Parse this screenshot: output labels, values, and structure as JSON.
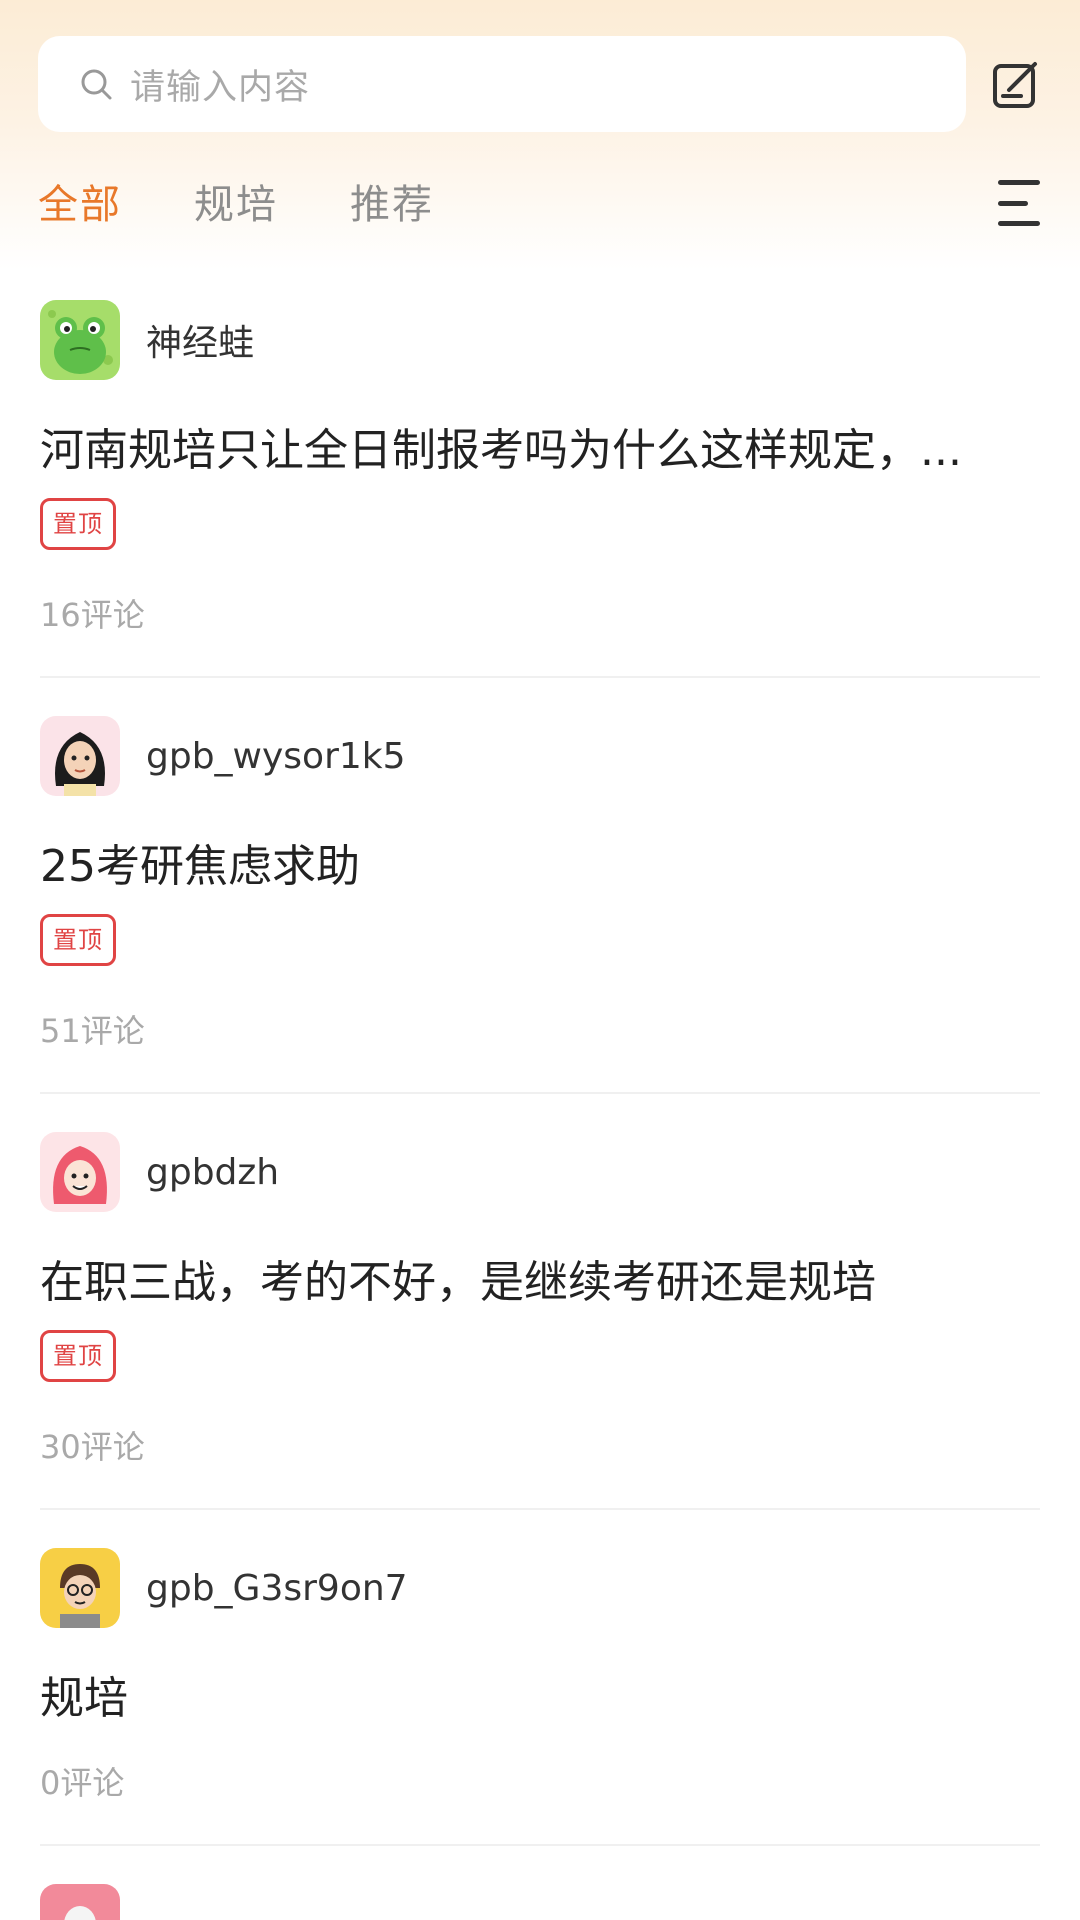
{
  "search": {
    "placeholder": "请输入内容"
  },
  "tabs": [
    {
      "label": "全部",
      "active": true
    },
    {
      "label": "规培",
      "active": false
    },
    {
      "label": "推荐",
      "active": false
    }
  ],
  "posts": [
    {
      "author": "神经蛙",
      "title": "河南规培只让全日制报考吗为什么这样规定，...",
      "badge": "置顶",
      "comments": "16评论",
      "avatar": "frog"
    },
    {
      "author": "gpb_wysor1k5",
      "title": "25考研焦虑求助",
      "badge": "置顶",
      "comments": "51评论",
      "avatar": "girl-dark-hair"
    },
    {
      "author": "gpbdzh",
      "title": "在职三战，考的不好，是继续考研还是规培",
      "badge": "置顶",
      "comments": "30评论",
      "avatar": "girl-red-hair"
    },
    {
      "author": "gpb_G3sr9on7",
      "title": "规培",
      "badge": "",
      "comments": "0评论",
      "avatar": "person-glasses"
    }
  ],
  "colors": {
    "accent": "#e8782a",
    "badge": "#e04444",
    "muted": "#a9a9a9"
  }
}
